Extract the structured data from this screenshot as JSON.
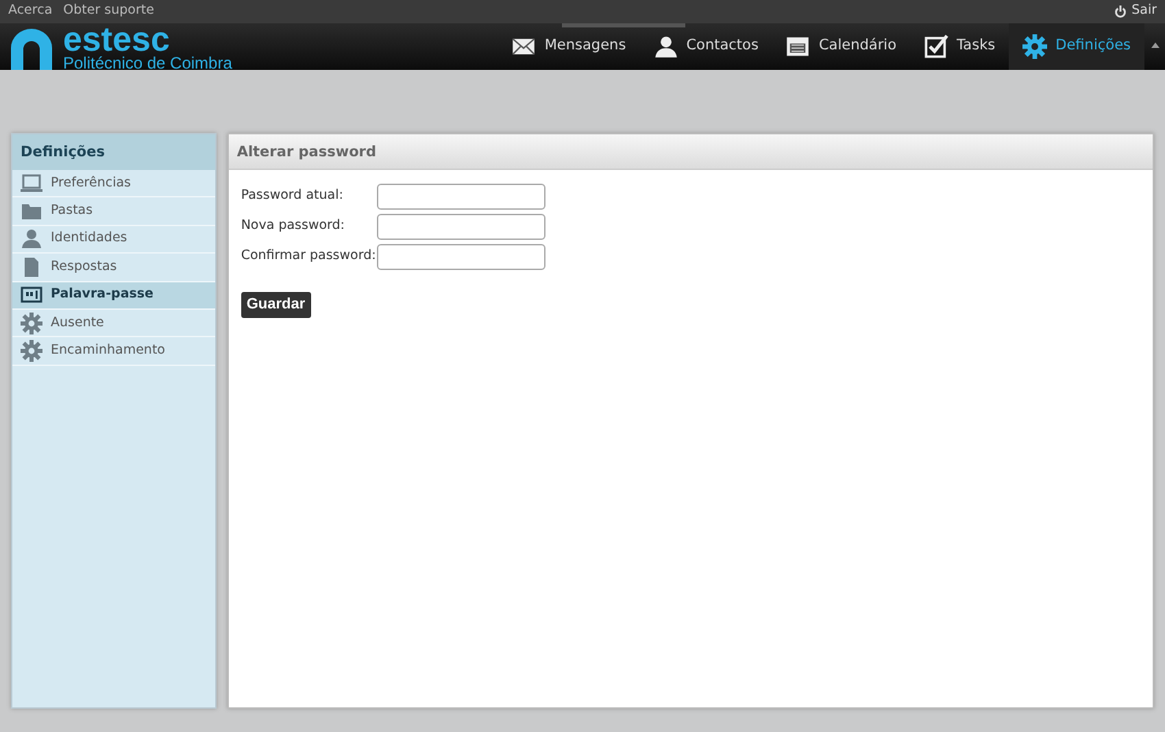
{
  "top_links": [
    "Acerca",
    "Obter suporte"
  ],
  "logout": {
    "label": "Sair"
  },
  "logo": {
    "name": "estesc",
    "subtitle": "Politécnico de Coimbra"
  },
  "nav": [
    {
      "label": "Mensagens",
      "kind": "mail",
      "selected": false
    },
    {
      "label": "Contactos",
      "kind": "person",
      "selected": false
    },
    {
      "label": "Calendário",
      "kind": "calendar",
      "selected": false
    },
    {
      "label": "Tasks",
      "kind": "check",
      "selected": false
    },
    {
      "label": "Definições",
      "kind": "gear",
      "selected": true
    }
  ],
  "sidebar": {
    "title": "Definições",
    "items": [
      {
        "label": "Preferências",
        "kind": "laptop",
        "selected": false
      },
      {
        "label": "Pastas",
        "kind": "folder",
        "selected": false
      },
      {
        "label": "Identidades",
        "kind": "person",
        "selected": false
      },
      {
        "label": "Respostas",
        "kind": "doc",
        "selected": false
      },
      {
        "label": "Palavra-passe",
        "kind": "key",
        "selected": true
      },
      {
        "label": "Ausente",
        "kind": "gear",
        "selected": false
      },
      {
        "label": "Encaminhamento",
        "kind": "gear",
        "selected": false
      }
    ]
  },
  "panel": {
    "title": "Alterar password",
    "fields": [
      {
        "label": "Password atual:"
      },
      {
        "label": "Nova password:"
      },
      {
        "label": "Confirmar password:"
      }
    ],
    "button": "Guardar"
  }
}
